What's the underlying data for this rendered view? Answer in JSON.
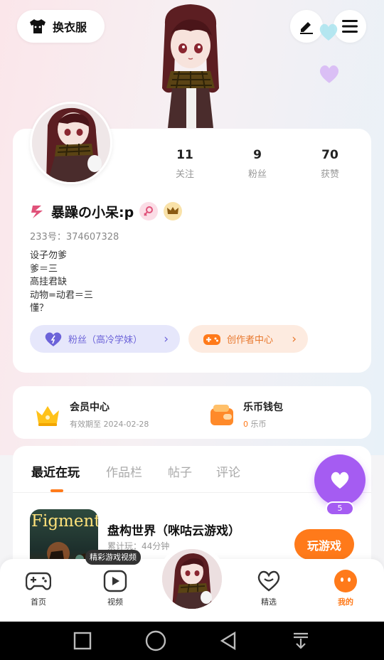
{
  "header": {
    "dress_label": "换衣服"
  },
  "stats": [
    {
      "value": "11",
      "label": "关注"
    },
    {
      "value": "9",
      "label": "粉丝"
    },
    {
      "value": "70",
      "label": "获赞"
    }
  ],
  "profile": {
    "username": "暴躁の小呆:p",
    "uid": "233号：374607328",
    "bio": "设子勿爹\n爹＝三\n高挂君缺\n动物=动君＝三\n懂？"
  },
  "actions": {
    "fans": "粉丝（高冷学妹）",
    "creator": "创作者中心"
  },
  "wallet": {
    "member_title": "会员中心",
    "member_sub": "有效期至 2024-02-28",
    "coin_title": "乐币钱包",
    "coin_amount": "0",
    "coin_unit": "乐币"
  },
  "tabs": [
    "最近在玩",
    "作品栏",
    "帖子",
    "评论"
  ],
  "game": {
    "thumb_text": "Figment",
    "title": "盘构世界（咪咕云游戏）",
    "sub": "累计玩：44分钟",
    "play_label": "玩游戏"
  },
  "fab": {
    "count": "5"
  },
  "nav": {
    "home": "首页",
    "video": "视频",
    "featured": "精选",
    "mine": "我的",
    "tooltip": "精彩游戏视频"
  },
  "colors": {
    "accent": "#ff7a1a",
    "purple": "#a55cf2",
    "fans_pill": "#e6e7fb",
    "creator_pill": "#fdebe0"
  }
}
